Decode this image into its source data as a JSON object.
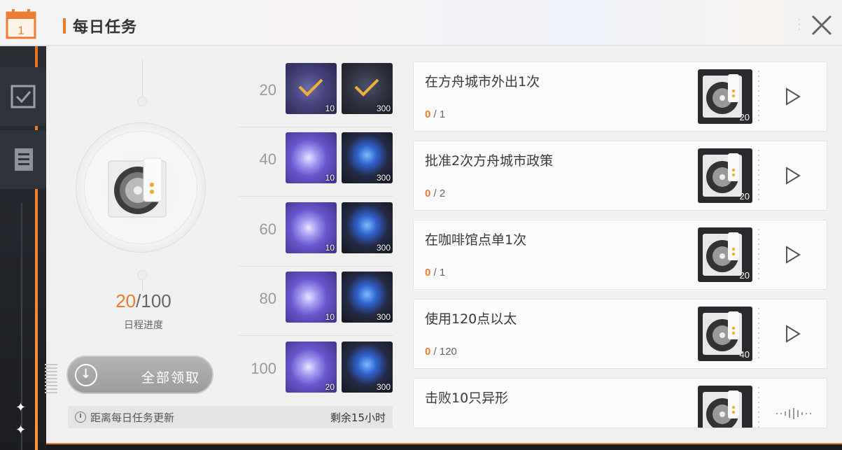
{
  "header": {
    "calendar_day": "1",
    "title": "每日任务"
  },
  "progress": {
    "current": "20",
    "separator": "/",
    "total": "100",
    "label": "日程进度"
  },
  "claim_all_label": "全部领取",
  "refresh": {
    "label": "距离每日任务更新",
    "remaining": "剩余15小时"
  },
  "milestones": [
    {
      "level": "20",
      "rewards": [
        {
          "icon": "crystal",
          "qty": "10",
          "claimed": true
        },
        {
          "icon": "chest",
          "qty": "300",
          "claimed": true
        }
      ]
    },
    {
      "level": "40",
      "rewards": [
        {
          "icon": "crystal",
          "qty": "10",
          "claimed": false
        },
        {
          "icon": "chest",
          "qty": "300",
          "claimed": false
        }
      ]
    },
    {
      "level": "60",
      "rewards": [
        {
          "icon": "crystal",
          "qty": "10",
          "claimed": false
        },
        {
          "icon": "chest",
          "qty": "300",
          "claimed": false
        }
      ]
    },
    {
      "level": "80",
      "rewards": [
        {
          "icon": "crystal",
          "qty": "10",
          "claimed": false
        },
        {
          "icon": "chest",
          "qty": "300",
          "claimed": false
        }
      ]
    },
    {
      "level": "100",
      "rewards": [
        {
          "icon": "crystal",
          "qty": "20",
          "claimed": false
        },
        {
          "icon": "chest",
          "qty": "300",
          "claimed": false
        }
      ]
    }
  ],
  "tasks": [
    {
      "name": "在方舟城市外出1次",
      "current": "0",
      "total": "/ 1",
      "reward_qty": "20",
      "action": "play"
    },
    {
      "name": "批准2次方舟城市政策",
      "current": "0",
      "total": "/ 2",
      "reward_qty": "20",
      "action": "play"
    },
    {
      "name": "在咖啡馆点单1次",
      "current": "0",
      "total": "/ 1",
      "reward_qty": "20",
      "action": "play"
    },
    {
      "name": "使用120点以太",
      "current": "0",
      "total": "/ 120",
      "reward_qty": "40",
      "action": "play"
    },
    {
      "name": "击败10只异形",
      "current": "",
      "total": "",
      "reward_qty": "",
      "action": "loading"
    }
  ],
  "colors": {
    "accent": "#ef7a2a",
    "panel": "#f0f0f0",
    "dark": "#1f2127"
  },
  "icons": [
    "calendar-icon",
    "checkbox-icon",
    "notes-icon",
    "close-icon",
    "play-icon",
    "disc-icon",
    "crystal-icon",
    "chest-icon",
    "check-icon",
    "download-icon",
    "clock-icon"
  ]
}
